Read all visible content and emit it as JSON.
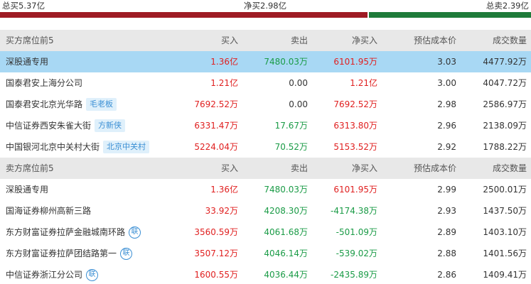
{
  "summary": {
    "total_buy": "总买5.37亿",
    "net_buy": "净买2.98亿",
    "total_sell": "总卖2.39亿",
    "bar_buy_fraction": 0.692
  },
  "colors": {
    "buy_bar": "#9e1b24",
    "sell_bar": "#1e7b3a",
    "up": "#e02020",
    "down": "#1a9b46",
    "highlight": "#a8d8f4"
  },
  "buy_section": {
    "header": {
      "name": "买方席位前5",
      "buy": "买入",
      "sell": "卖出",
      "net": "净买入",
      "cost": "预估成本价",
      "vol": "成交数量"
    },
    "rows": [
      {
        "name": "深股通专用",
        "tag": "",
        "badge": "",
        "buy": "1.36亿",
        "sell": "7480.03万",
        "net": "6101.95万",
        "cost": "3.03",
        "vol": "4477.92万",
        "highlight": true
      },
      {
        "name": "国泰君安上海分公司",
        "tag": "",
        "badge": "",
        "buy": "1.21亿",
        "sell": "0.00",
        "net": "1.21亿",
        "cost": "3.00",
        "vol": "4047.72万",
        "highlight": false
      },
      {
        "name": "国泰君安北京光华路",
        "tag": "毛老板",
        "badge": "",
        "buy": "7692.52万",
        "sell": "0.00",
        "net": "7692.52万",
        "cost": "2.98",
        "vol": "2586.97万",
        "highlight": false
      },
      {
        "name": "中信证券西安朱雀大街",
        "tag": "方新侠",
        "badge": "",
        "buy": "6331.47万",
        "sell": "17.67万",
        "net": "6313.80万",
        "cost": "2.96",
        "vol": "2138.09万",
        "highlight": false
      },
      {
        "name": "中国银河北京中关村大街",
        "tag": "北京中关村",
        "badge": "",
        "buy": "5224.04万",
        "sell": "70.52万",
        "net": "5153.52万",
        "cost": "2.92",
        "vol": "1788.22万",
        "highlight": false
      }
    ]
  },
  "sell_section": {
    "header": {
      "name": "卖方席位前5",
      "buy": "买入",
      "sell": "卖出",
      "net": "净买入",
      "cost": "预估成本价",
      "vol": "成交数量"
    },
    "rows": [
      {
        "name": "深股通专用",
        "tag": "",
        "badge": "",
        "buy": "1.36亿",
        "sell": "7480.03万",
        "net": "6101.95万",
        "cost": "2.99",
        "vol": "2500.01万",
        "highlight": false
      },
      {
        "name": "国海证券柳州高新三路",
        "tag": "",
        "badge": "",
        "buy": "33.92万",
        "sell": "4208.30万",
        "net": "-4174.38万",
        "cost": "2.93",
        "vol": "1437.50万",
        "highlight": false
      },
      {
        "name": "东方财富证券拉萨金融城南环路",
        "tag": "",
        "badge": "联",
        "buy": "3560.59万",
        "sell": "4061.68万",
        "net": "-501.09万",
        "cost": "2.89",
        "vol": "1403.10万",
        "highlight": false
      },
      {
        "name": "东方财富证券拉萨团结路第一",
        "tag": "",
        "badge": "联",
        "buy": "3507.12万",
        "sell": "4046.14万",
        "net": "-539.02万",
        "cost": "2.88",
        "vol": "1401.56万",
        "highlight": false
      },
      {
        "name": "中信证券浙江分公司",
        "tag": "",
        "badge": "联",
        "buy": "1600.55万",
        "sell": "4036.44万",
        "net": "-2435.89万",
        "cost": "2.86",
        "vol": "1409.41万",
        "highlight": false
      }
    ]
  }
}
